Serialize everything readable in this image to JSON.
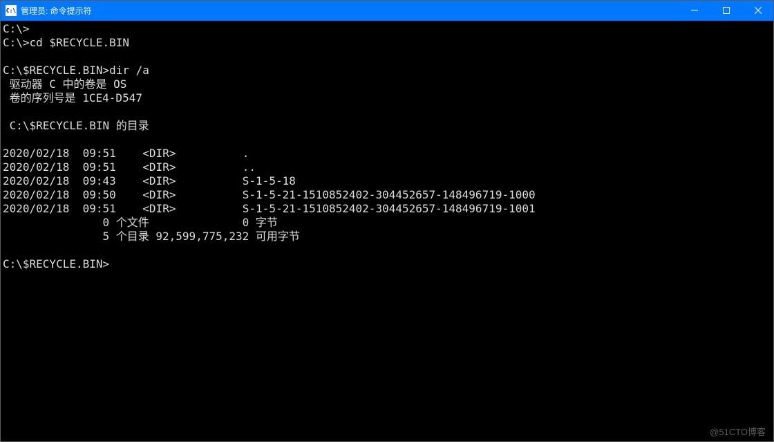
{
  "window": {
    "title": "管理员: 命令提示符",
    "icon_label": "C:\\"
  },
  "terminal": {
    "lines": [
      "C:\\>",
      "C:\\>cd $RECYCLE.BIN",
      "",
      "C:\\$RECYCLE.BIN>dir /a",
      " 驱动器 C 中的卷是 OS",
      " 卷的序列号是 1CE4-D547",
      "",
      " C:\\$RECYCLE.BIN 的目录",
      "",
      "2020/02/18  09:51    <DIR>          .",
      "2020/02/18  09:51    <DIR>          ..",
      "2020/02/18  09:43    <DIR>          S-1-5-18",
      "2020/02/18  09:50    <DIR>          S-1-5-21-1510852402-304452657-148496719-1000",
      "2020/02/18  09:51    <DIR>          S-1-5-21-1510852402-304452657-148496719-1001",
      "               0 个文件              0 字节",
      "               5 个目录 92,599,775,232 可用字节",
      "",
      "C:\\$RECYCLE.BIN>"
    ]
  },
  "watermark": "@51CTO博客"
}
